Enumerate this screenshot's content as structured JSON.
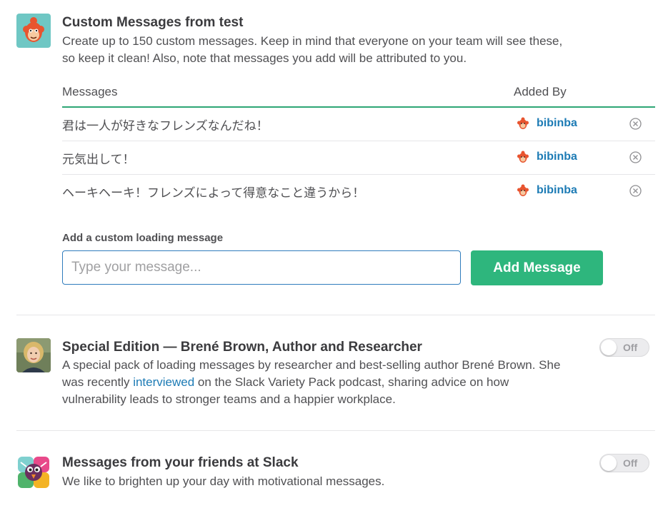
{
  "custom": {
    "title": "Custom Messages from test",
    "desc_line1": "Create up to 150 custom messages. Keep in mind that everyone on your team will see these,",
    "desc_line2": "so keep it clean! Also, note that messages you add will be attributed to you.",
    "table": {
      "col_messages": "Messages",
      "col_added_by": "Added By",
      "rows": [
        {
          "message": "君は一人が好きなフレンズなんだね！",
          "user": "bibinba"
        },
        {
          "message": "元気出して！",
          "user": "bibinba"
        },
        {
          "message": "ヘーキヘーキ！フレンズによって得意なこと違うから！",
          "user": "bibinba"
        }
      ]
    },
    "add_label": "Add a custom loading message",
    "input_placeholder": "Type your message...",
    "input_value": "",
    "add_button": "Add Message"
  },
  "brene": {
    "title": "Special Edition — Brené Brown, Author and Researcher",
    "desc_line1": "A special pack of loading messages by researcher and best-selling author Brené Brown. She",
    "desc_line2_pre": "was recently ",
    "desc_link": "interviewed",
    "desc_line2_post": " on the Slack Variety Pack podcast, sharing advice on how",
    "desc_line3": "vulnerability leads to stronger teams and a happier workplace.",
    "toggle": "Off"
  },
  "slack": {
    "title": "Messages from your friends at Slack",
    "desc": "We like to brighten up your day with motivational messages.",
    "toggle": "Off"
  },
  "icons": {
    "team_avatar": "monkey-avatar-icon",
    "row_user": "monkey-mini-icon",
    "remove": "circle-x-icon",
    "brene_avatar": "woman-photo-avatar",
    "slack_avatar": "slack-bird-icon"
  },
  "colors": {
    "accent_green": "#2eb67d",
    "link_blue": "#1d7bb5",
    "input_border": "#2f7cbd",
    "avatar_teal": "#6fc7c4",
    "monkey_orange": "#e8542f"
  }
}
